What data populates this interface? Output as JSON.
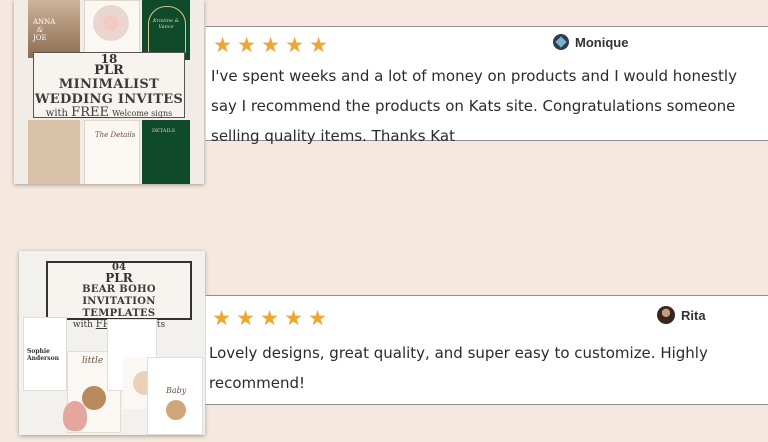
{
  "reviews": [
    {
      "rating": 5,
      "stars": [
        "★",
        "★",
        "★",
        "★",
        "★"
      ],
      "reviewer": "Monique",
      "avatar_icon": "monique-avatar-icon",
      "text_lines": [
        "I've spent weeks and a lot of money on products and I would honestly",
        "say I recommend the products on Kats site. Congratulations someone",
        "selling quality items. Thanks Kat"
      ],
      "product": {
        "number": "18",
        "prefix": "PLR",
        "title_lines": [
          "MINIMALIST",
          "WEDDING INVITES"
        ],
        "with": "with",
        "free": "FREE",
        "extra": "Welcome signs",
        "tile_texts": {
          "anna": "ANNA",
          "amp": "&",
          "joe": "JOE",
          "green_names": "Kristine & Vance",
          "details": "The Details",
          "details2": "DETAILS"
        }
      }
    },
    {
      "rating": 5,
      "stars": [
        "★",
        "★",
        "★",
        "★",
        "★"
      ],
      "reviewer": "Rita",
      "avatar_icon": "rita-avatar-icon",
      "text_lines": [
        "Lovely designs, great quality, and super easy to customize. Highly",
        "recommend!"
      ],
      "product": {
        "number": "04",
        "prefix": "PLR",
        "title_lines": [
          "BEAR BOHO INVITATION",
          "TEMPLATES"
        ],
        "with": "with",
        "free": "FREE",
        "extra": "clip arts",
        "tile_texts": {
          "sophie": "Sophie Anderson",
          "little": "little",
          "baby": "Baby"
        }
      }
    }
  ],
  "colors": {
    "page_bg": "#f5e9df",
    "star": "#efa52f",
    "text": "#2b2b2b",
    "dark_green": "#0f4a2a",
    "card_border": "#8e8e8e"
  }
}
